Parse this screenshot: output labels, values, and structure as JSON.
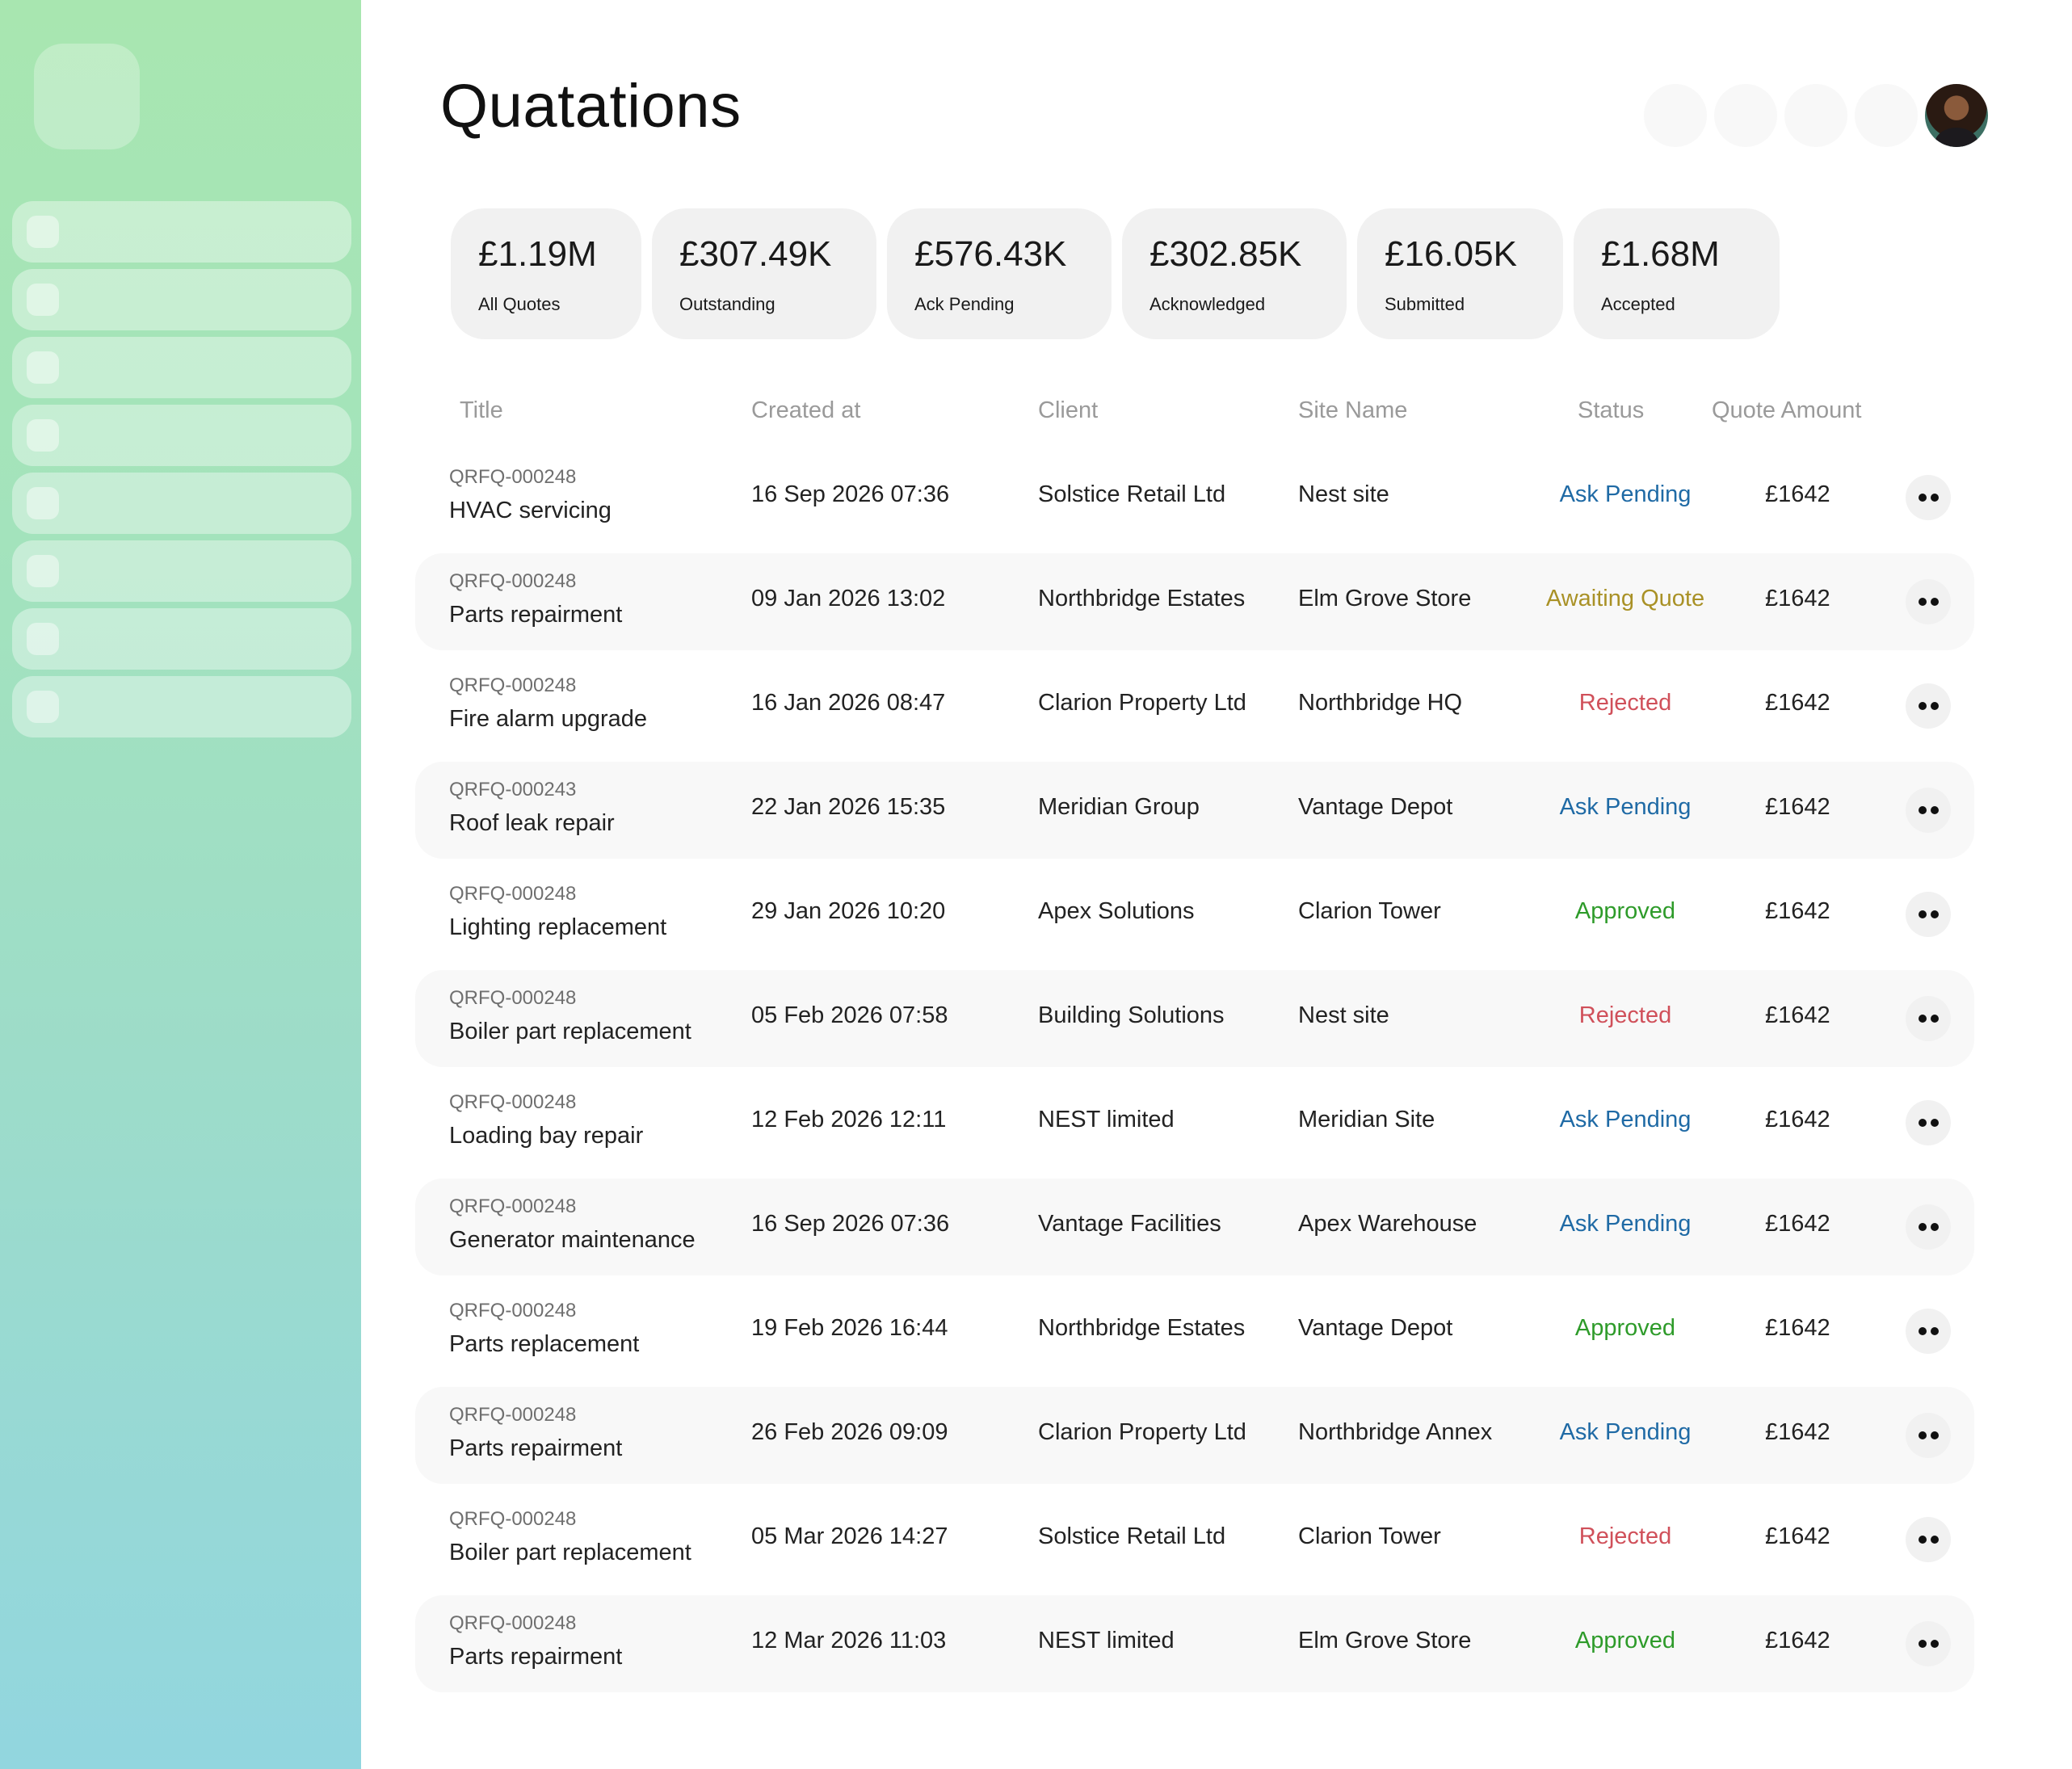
{
  "page": {
    "title": "Quatations"
  },
  "colors": {
    "sidebar_gradient_top": "#a8e6b0",
    "sidebar_gradient_bottom": "#92d6df",
    "status_ask_pending": "#1f6aa5",
    "status_awaiting_quote": "#a99126",
    "status_rejected": "#d0505a",
    "status_approved": "#2e9b2a"
  },
  "stats": [
    {
      "value": "£1.19M",
      "label": "All Quotes"
    },
    {
      "value": "£307.49K",
      "label": "Outstanding"
    },
    {
      "value": "£576.43K",
      "label": "Ack Pending"
    },
    {
      "value": "£302.85K",
      "label": "Acknowledged"
    },
    {
      "value": "£16.05K",
      "label": "Submitted"
    },
    {
      "value": "£1.68M",
      "label": "Accepted"
    }
  ],
  "table": {
    "columns": {
      "title": "Title",
      "created": "Created at",
      "client": "Client",
      "site": "Site Name",
      "status": "Status",
      "amount": "Quote Amount"
    },
    "rows": [
      {
        "id": "QRFQ-000248",
        "title": "HVAC servicing",
        "created": "16 Sep 2026 07:36",
        "client": "Solstice Retail Ltd",
        "site": "Nest site",
        "status": "Ask Pending",
        "status_key": "ask_pending",
        "amount": "£1642"
      },
      {
        "id": "QRFQ-000248",
        "title": "Parts repairment",
        "created": "09 Jan 2026 13:02",
        "client": "Northbridge Estates",
        "site": "Elm Grove Store",
        "status": "Awaiting Quote",
        "status_key": "awaiting_quote",
        "amount": "£1642"
      },
      {
        "id": "QRFQ-000248",
        "title": "Fire alarm upgrade",
        "created": "16 Jan 2026 08:47",
        "client": "Clarion Property Ltd",
        "site": "Northbridge HQ",
        "status": "Rejected",
        "status_key": "rejected",
        "amount": "£1642"
      },
      {
        "id": "QRFQ-000243",
        "title": "Roof leak repair",
        "created": "22 Jan 2026 15:35",
        "client": "Meridian Group",
        "site": "Vantage Depot",
        "status": "Ask Pending",
        "status_key": "ask_pending",
        "amount": "£1642"
      },
      {
        "id": "QRFQ-000248",
        "title": "Lighting replacement",
        "created": "29 Jan 2026 10:20",
        "client": "Apex Solutions",
        "site": "Clarion Tower",
        "status": "Approved",
        "status_key": "approved",
        "amount": "£1642"
      },
      {
        "id": "QRFQ-000248",
        "title": "Boiler part replacement",
        "created": "05 Feb 2026 07:58",
        "client": "Building Solutions",
        "site": "Nest site",
        "status": "Rejected",
        "status_key": "rejected",
        "amount": "£1642"
      },
      {
        "id": "QRFQ-000248",
        "title": "Loading bay repair",
        "created": "12 Feb 2026 12:11",
        "client": "NEST limited",
        "site": "Meridian Site",
        "status": "Ask Pending",
        "status_key": "ask_pending",
        "amount": "£1642"
      },
      {
        "id": "QRFQ-000248",
        "title": "Generator maintenance",
        "created": "16 Sep 2026 07:36",
        "client": "Vantage Facilities",
        "site": "Apex Warehouse",
        "status": "Ask Pending",
        "status_key": "ask_pending",
        "amount": "£1642"
      },
      {
        "id": "QRFQ-000248",
        "title": "Parts replacement",
        "created": "19 Feb 2026 16:44",
        "client": "Northbridge Estates",
        "site": "Vantage Depot",
        "status": "Approved",
        "status_key": "approved",
        "amount": "£1642"
      },
      {
        "id": "QRFQ-000248",
        "title": "Parts repairment",
        "created": "26 Feb 2026 09:09",
        "client": "Clarion Property Ltd",
        "site": "Northbridge Annex",
        "status": "Ask Pending",
        "status_key": "ask_pending",
        "amount": "£1642"
      },
      {
        "id": "QRFQ-000248",
        "title": "Boiler part replacement",
        "created": "05 Mar 2026 14:27",
        "client": "Solstice Retail Ltd",
        "site": "Clarion Tower",
        "status": "Rejected",
        "status_key": "rejected",
        "amount": "£1642"
      },
      {
        "id": "QRFQ-000248",
        "title": "Parts repairment",
        "created": "12 Mar 2026 11:03",
        "client": "NEST limited",
        "site": "Elm Grove Store",
        "status": "Approved",
        "status_key": "approved",
        "amount": "£1642"
      }
    ],
    "row_action_icon": "more-dots-icon"
  },
  "header": {
    "action_icons": [
      "header-action-icon",
      "header-action-icon",
      "header-action-icon",
      "header-action-icon"
    ],
    "avatar_icon": "user-avatar"
  },
  "sidebar": {
    "logo_icon": "app-logo-icon",
    "item_count_note": null
  }
}
